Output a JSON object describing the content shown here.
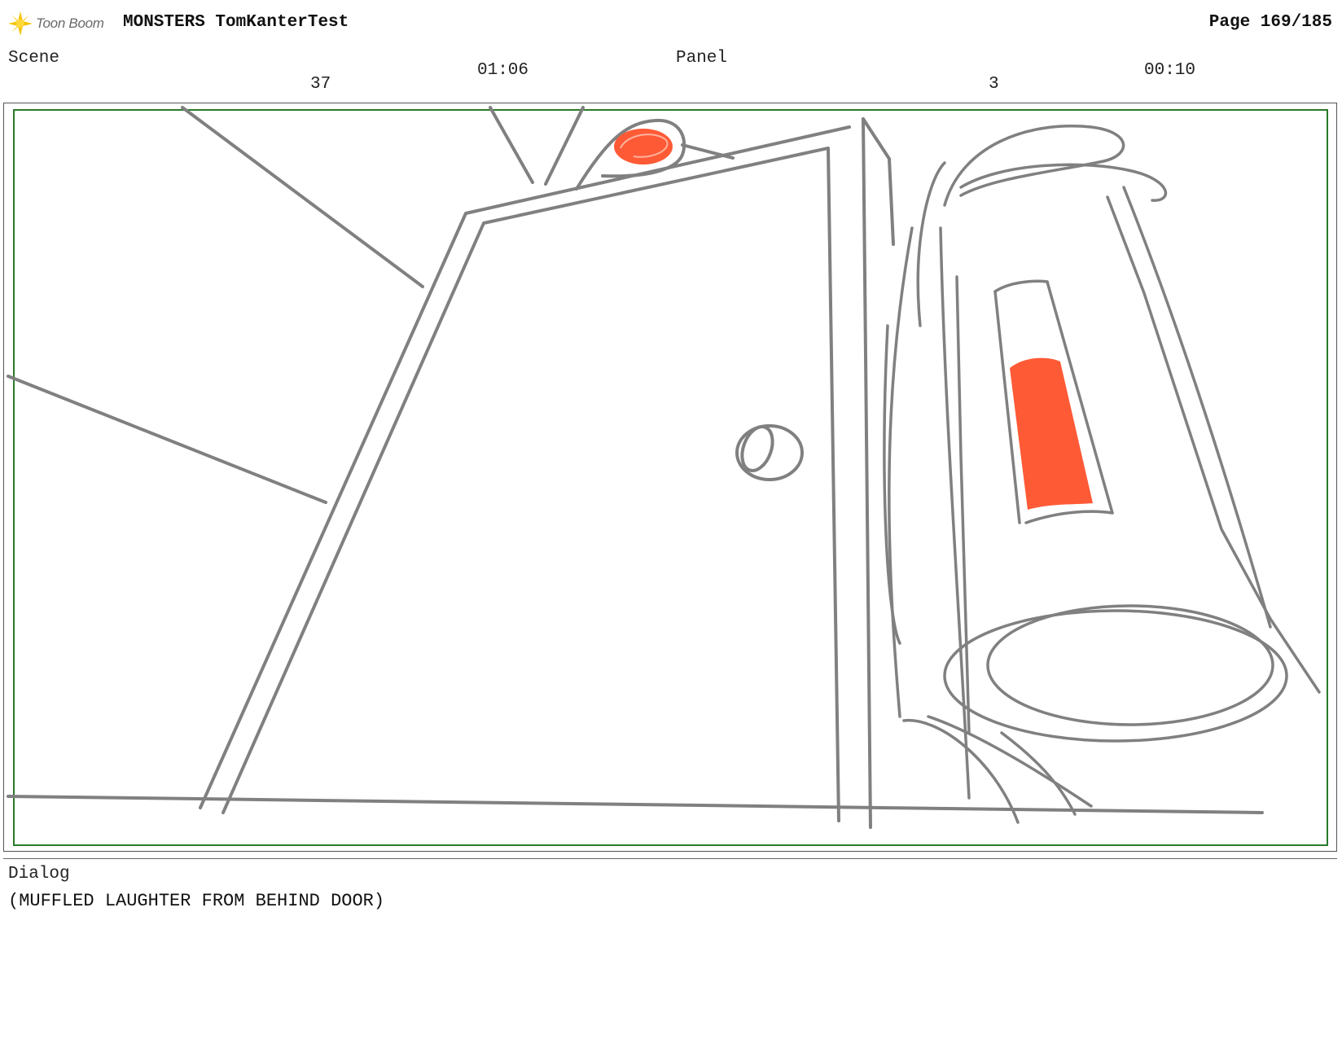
{
  "header": {
    "logo_text": "Toon Boom",
    "title": "MONSTERS TomKanterTest",
    "page": "Page 169/185"
  },
  "meta": {
    "scene_label": "Scene",
    "scene_number": "37",
    "scene_duration": "01:06",
    "panel_label": "Panel",
    "panel_number": "3",
    "panel_duration": "00:10"
  },
  "dialog": {
    "label": "Dialog",
    "text": "(MUFFLED LAUGHTER FROM BEHIND DOOR)"
  },
  "colors": {
    "frame_border": "#2a7a2a",
    "sketch_line": "#808080",
    "accent_red": "#ff5a36",
    "logo_yellow": "#f5c400"
  }
}
